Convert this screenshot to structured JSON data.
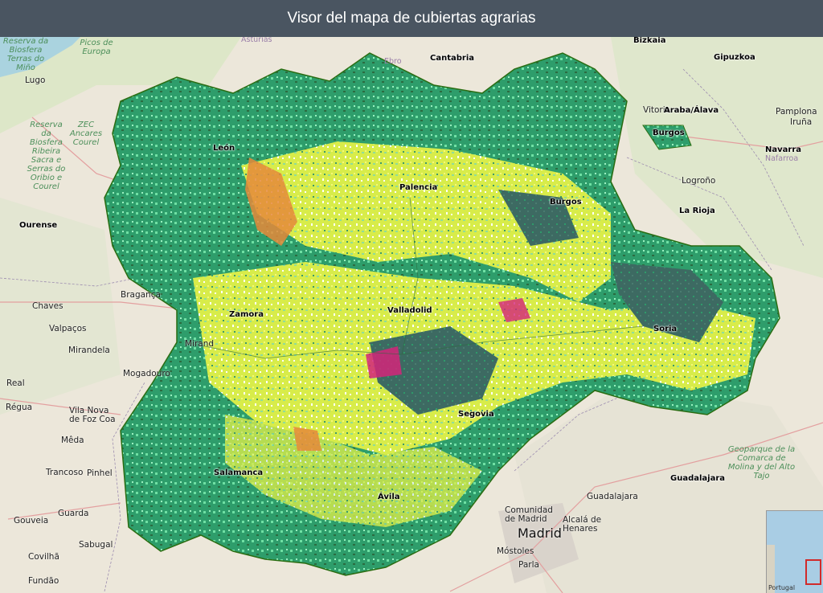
{
  "header": {
    "title": "Visor del mapa de cubiertas agrarias"
  },
  "colors": {
    "header_bg": "#4a5561",
    "basemap": "#e8e4d8",
    "forest": "#2f9a6a",
    "dark_forest": "#3a6a5a",
    "crop_yellow": "#e5ee4e",
    "light_green": "#7ee6a8",
    "orange": "#e58a3a",
    "magenta": "#d4247a",
    "region_border": "#2a6d12"
  },
  "labels": {
    "reserva_biosfera": "Reserva da Biosfera Terras do Miño",
    "lugo": "Lugo",
    "asturias": "Asturias",
    "picos_de_europa": "Picos de Europa",
    "cantabria": "Cantabria",
    "ebro": "Ebro",
    "bizkaia": "Bizkaia",
    "gipuzkoa": "Gipuzkoa",
    "vitoria": "Vitoria",
    "araba": "Araba/Álava",
    "pamplona": "Pamplona",
    "irunea": "Iruña",
    "navarra": "Navarra",
    "nafarroa": "Nafarroa",
    "burgos_n": "Burgos",
    "reserva_ribeira": "Reserva da Biosfera Ribeira Sacra e Serras do Oribio e Courel",
    "zec": "ZEC Ancares Courel",
    "leon": "León",
    "palencia": "Palencia",
    "burgos": "Burgos",
    "logrono": "Logroño",
    "la_rioja": "La Rioja",
    "ourense": "Ourense",
    "chaves": "Chaves",
    "braganca": "Bragança",
    "zamora": "Zamora",
    "valladolid": "Valladolid",
    "soria": "Soria",
    "valpacos": "Valpaços",
    "mirandela": "Mirandela",
    "miranda": "Mirand",
    "mogadouro": "Mogadouro",
    "real": "Real",
    "regua": "Régua",
    "vila_nova": "Vila Nova de Foz Coa",
    "meda": "Mêda",
    "segovia": "Segovia",
    "trancoso": "Trancoso",
    "pinhel": "Pinhel",
    "salamanca": "Salamanca",
    "guadalajara": "Guadalajara",
    "guadalajara_c": "Guadalajara",
    "geoparque": "Geoparque de la Comarca de Molina y del Alto Tajo",
    "avila": "Ávila",
    "guarda": "Guarda",
    "gouveia": "Gouveia",
    "comunidad": "Comunidad de Madrid",
    "madrid": "Madrid",
    "alcala": "Alcalá de Henares",
    "sabugal": "Sabugal",
    "covilha": "Covilhã",
    "mostoles": "Móstoles",
    "parla": "Parla",
    "fundao": "Fundão",
    "portugal": "Portugal"
  }
}
